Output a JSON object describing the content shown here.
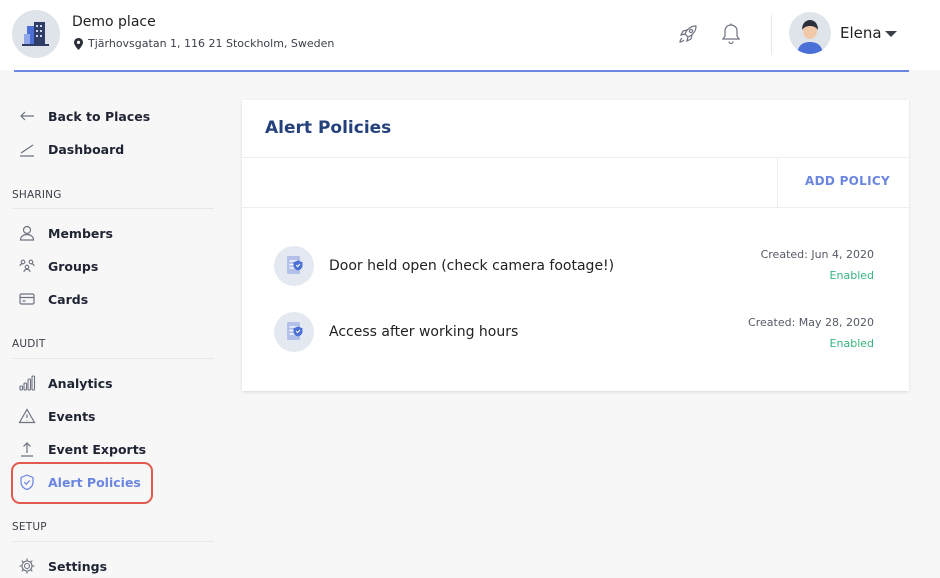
{
  "header": {
    "place_name": "Demo place",
    "place_address": "Tjärhovsgatan 1, 116 21 Stockholm, Sweden",
    "user_name": "Elena"
  },
  "sidebar": {
    "back": "Back to Places",
    "dashboard": "Dashboard",
    "sections": [
      {
        "label": "SHARING",
        "items": [
          "Members",
          "Groups",
          "Cards"
        ]
      },
      {
        "label": "AUDIT",
        "items": [
          "Analytics",
          "Events",
          "Event Exports",
          "Alert Policies"
        ]
      },
      {
        "label": "SETUP",
        "items": [
          "Settings"
        ]
      }
    ],
    "active_item": "Alert Policies"
  },
  "main": {
    "title": "Alert Policies",
    "add_button": "ADD POLICY",
    "policies": [
      {
        "name": "Door held open (check camera footage!)",
        "created": "Created: Jun 4, 2020",
        "status": "Enabled"
      },
      {
        "name": "Access after working hours",
        "created": "Created: May 28, 2020",
        "status": "Enabled"
      }
    ]
  },
  "colors": {
    "accent": "#6b86e0",
    "title": "#24417c",
    "enabled": "#36b37e",
    "highlight": "#e05a4d"
  }
}
